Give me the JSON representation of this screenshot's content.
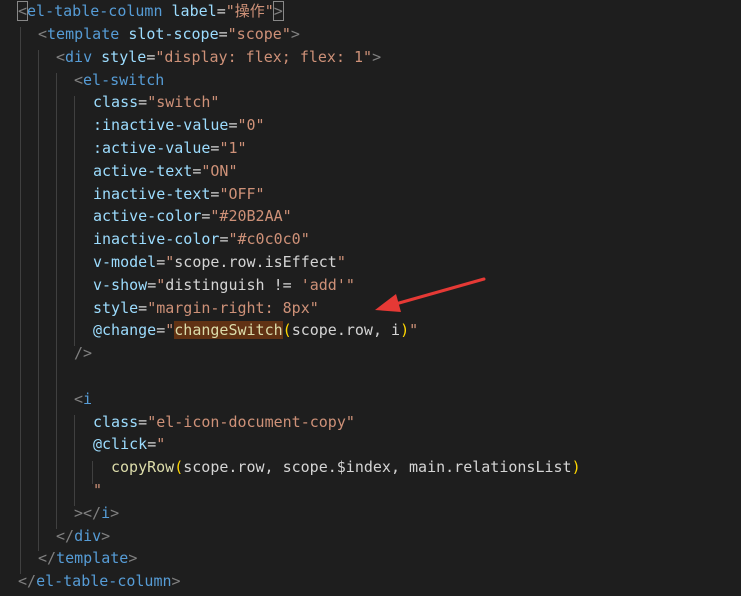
{
  "code": {
    "l1": {
      "lt": "<",
      "tag": "el-table-column",
      "attr": "label",
      "eq": "=",
      "val": "\"操作\"",
      "gt": ">"
    },
    "l2": {
      "lt": "<",
      "tag": "template",
      "attr": "slot-scope",
      "eq": "=",
      "val": "\"scope\"",
      "gt": ">"
    },
    "l3": {
      "lt": "<",
      "tag": "div",
      "attr": "style",
      "eq": "=",
      "val": "\"display: flex; flex: 1\"",
      "gt": ">"
    },
    "l4": {
      "lt": "<",
      "tag": "el-switch"
    },
    "l5": {
      "attr": "class",
      "eq": "=",
      "val": "\"switch\""
    },
    "l6": {
      "attr": ":inactive-value",
      "eq": "=",
      "val": "\"0\""
    },
    "l7": {
      "attr": ":active-value",
      "eq": "=",
      "val": "\"1\""
    },
    "l8": {
      "attr": "active-text",
      "eq": "=",
      "val": "\"ON\""
    },
    "l9": {
      "attr": "inactive-text",
      "eq": "=",
      "val": "\"OFF\""
    },
    "l10": {
      "attr": "active-color",
      "eq": "=",
      "val": "\"#20B2AA\""
    },
    "l11": {
      "attr": "inactive-color",
      "eq": "=",
      "val": "\"#c0c0c0\""
    },
    "l12": {
      "attr": "v-model",
      "eq": "=",
      "q1": "\"",
      "expr": "scope.row.isEffect",
      "q2": "\""
    },
    "l13": {
      "attr": "v-show",
      "eq": "=",
      "q1": "\"",
      "expr": "distinguish != ",
      "str": "'add'",
      "q2": "\""
    },
    "l14": {
      "attr": "style",
      "eq": "=",
      "val": "\"margin-right: 8px\""
    },
    "l15": {
      "attr": "@change",
      "eq": "=",
      "q1": "\"",
      "fn": "changeSwitch",
      "po": "(",
      "args": "scope.row, i",
      "pc": ")",
      "q2": "\""
    },
    "l16": {
      "close": "/>"
    },
    "l18": {
      "lt": "<",
      "tag": "i"
    },
    "l19": {
      "attr": "class",
      "eq": "=",
      "val": "\"el-icon-document-copy\""
    },
    "l20": {
      "attr": "@click",
      "eq": "=",
      "q1": "\""
    },
    "l21": {
      "fn": "copyRow",
      "po": "(",
      "args": "scope.row, scope.$index, main.relationsList",
      "pc": ")"
    },
    "l22": {
      "q2": "\""
    },
    "l23": {
      "gt": ">",
      "ltslash": "</",
      "tag": "i",
      "gt2": ">"
    },
    "l24": {
      "ltslash": "</",
      "tag": "div",
      "gt": ">"
    },
    "l25": {
      "ltslash": "</",
      "tag": "template",
      "gt": ">"
    },
    "l26": {
      "ltslash": "</",
      "tag": "el-table-column",
      "gt": ">"
    }
  },
  "annotation": {
    "color": "#e53935",
    "icon": "red-arrow-icon"
  }
}
